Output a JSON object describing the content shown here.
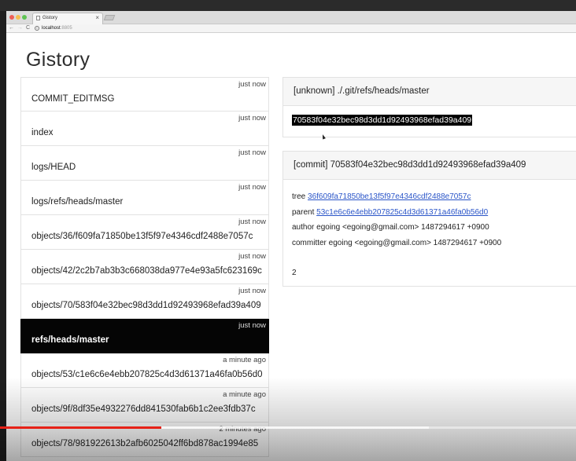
{
  "browser": {
    "tab_title": "Gistory",
    "tab_close": "×",
    "url_host": "localhost",
    "url_port": ":8805",
    "nav_back": "←",
    "nav_forward": "→",
    "nav_reload": "C",
    "url_icon": "i"
  },
  "page": {
    "title": "Gistory"
  },
  "files": [
    {
      "time": "just now",
      "name": "COMMIT_EDITMSG"
    },
    {
      "time": "just now",
      "name": "index"
    },
    {
      "time": "just now",
      "name": "logs/HEAD"
    },
    {
      "time": "just now",
      "name": "logs/refs/heads/master"
    },
    {
      "time": "just now",
      "name": "objects/36/f609fa71850be13f5f97e4346cdf2488e7057c"
    },
    {
      "time": "just now",
      "name": "objects/42/2c2b7ab3b3c668038da977e4e93a5fc623169c"
    },
    {
      "time": "just now",
      "name": "objects/70/583f04e32bec98d3dd1d92493968efad39a409"
    },
    {
      "time": "just now",
      "name": "refs/heads/master"
    },
    {
      "time": "a minute ago",
      "name": "objects/53/c1e6c6e4ebb207825c4d3d61371a46fa0b56d0"
    },
    {
      "time": "a minute ago",
      "name": "objects/9f/8df35e4932276dd841530fab6b1c2ee3fdb37c"
    },
    {
      "time": "2 minutes ago",
      "name": "objects/78/981922613b2afb6025042ff6bd878ac1994e85"
    }
  ],
  "selected_index": 7,
  "ref_panel": {
    "header": "[unknown] ./.git/refs/heads/master",
    "content": "70583f04e32bec98d3dd1d92493968efad39a409"
  },
  "commit_panel": {
    "header": "[commit] 70583f04e32bec98d3dd1d92493968efad39a409",
    "tree_label": "tree",
    "tree_hash": "36f609fa71850be13f5f97e4346cdf2488e7057c",
    "parent_label": "parent",
    "parent_hash": "53c1e6c6e4ebb207825c4d3d61371a46fa0b56d0",
    "author": "author egoing <egoing@gmail.com> 1487294617 +0900",
    "committer": "committer egoing <egoing@gmail.com> 1487294617 +0900",
    "message": "2"
  },
  "video": {
    "played_fraction": 0.28,
    "buffered_fraction": 0.745
  },
  "colors": {
    "accent_link": "#2a55c8",
    "progress_played": "#e62117",
    "selected_row": "#050505"
  }
}
